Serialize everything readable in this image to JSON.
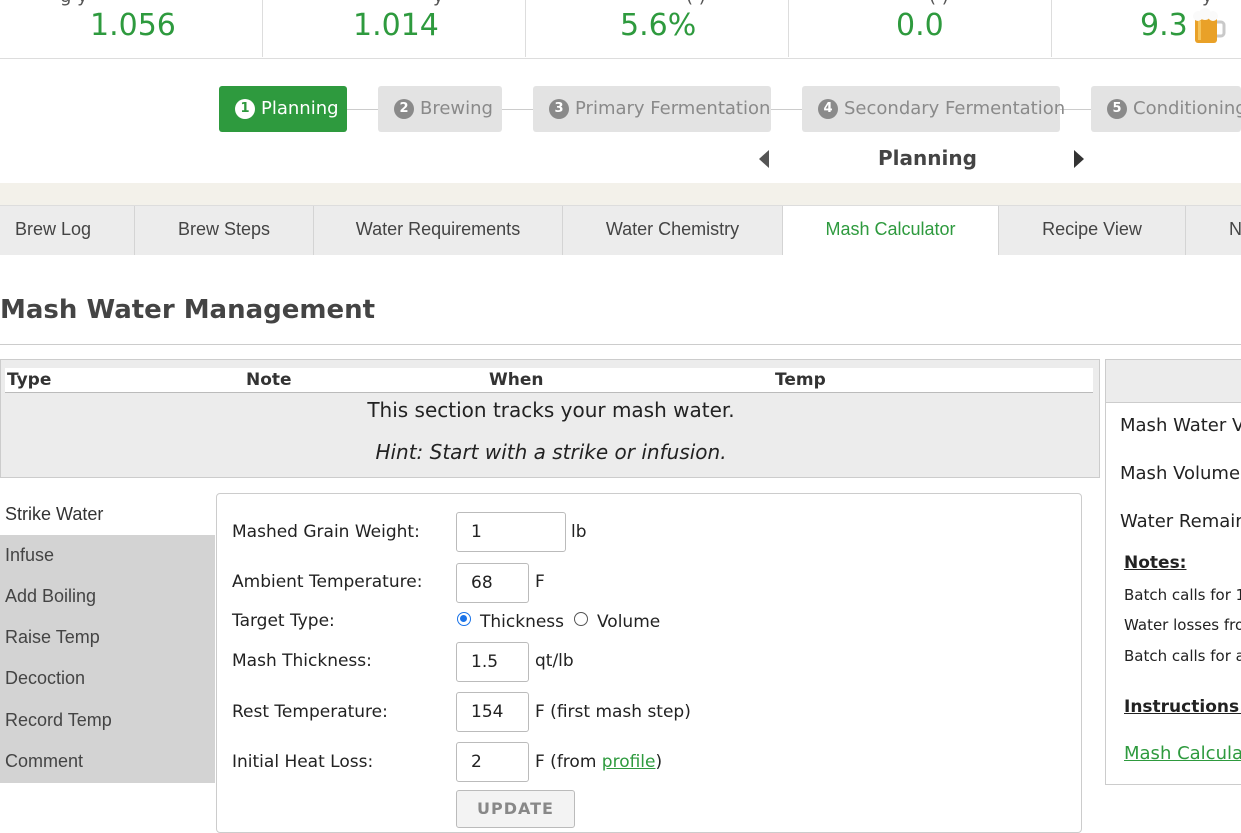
{
  "stats": [
    {
      "value": "1.056",
      "cut_label": "g       y"
    },
    {
      "value": "1.014",
      "cut_label": "y"
    },
    {
      "value": "5.6%",
      "cut_label": "(      )"
    },
    {
      "value": "0.0",
      "cut_label": "(      )"
    },
    {
      "value": "9.3",
      "cut_label": "y"
    }
  ],
  "steps": [
    {
      "num": "1",
      "label": "Planning"
    },
    {
      "num": "2",
      "label": "Brewing"
    },
    {
      "num": "3",
      "label": "Primary Fermentation"
    },
    {
      "num": "4",
      "label": "Secondary Fermentation"
    },
    {
      "num": "5",
      "label": "Conditioning"
    }
  ],
  "current_stage": "Planning",
  "tabs": [
    "Brew Log",
    "Brew Steps",
    "Water Requirements",
    "Water Chemistry",
    "Mash Calculator",
    "Recipe View",
    "N"
  ],
  "section_title": "Mash Water Management",
  "mash_table": {
    "columns": [
      "Type",
      "Note",
      "When",
      "Temp"
    ],
    "empty_message": "This section tracks your mash water.",
    "hint": "Hint: Start with a strike or infusion."
  },
  "side_menu": [
    "Strike Water",
    "Infuse",
    "Add Boiling",
    "Raise Temp",
    "Decoction",
    "Record Temp",
    "Comment"
  ],
  "form": {
    "grain_weight": {
      "label": "Mashed Grain Weight:",
      "value": "1",
      "unit": "lb"
    },
    "ambient_temp": {
      "label": "Ambient Temperature:",
      "value": "68",
      "unit": "F"
    },
    "target_type": {
      "label": "Target Type:",
      "option1": "Thickness",
      "option2": "Volume"
    },
    "thickness": {
      "label": "Mash Thickness:",
      "value": "1.5",
      "unit": "qt/lb"
    },
    "rest_temp": {
      "label": "Rest Temperature:",
      "value": "154",
      "unit": "F  (first mash step)"
    },
    "heat_loss": {
      "label": "Initial Heat Loss:",
      "value": "2",
      "unit_prefix": "F  (from ",
      "link": "profile",
      "unit_suffix": ")"
    },
    "update_label": "UPDATE"
  },
  "right_panel": {
    "row1": "Mash Water V",
    "row2": "Mash Volume",
    "row3": "Water Remain",
    "notes_title": "Notes:",
    "note1": "Batch calls for 1",
    "note2": "Water losses fro",
    "note3": "Batch calls for a",
    "instructions_title": "Instructions:",
    "link": "Mash Calcula"
  },
  "colors": {
    "accent": "#2e9a3e",
    "tab_bg": "#ececec",
    "menu_bg": "#d3d3d3"
  }
}
